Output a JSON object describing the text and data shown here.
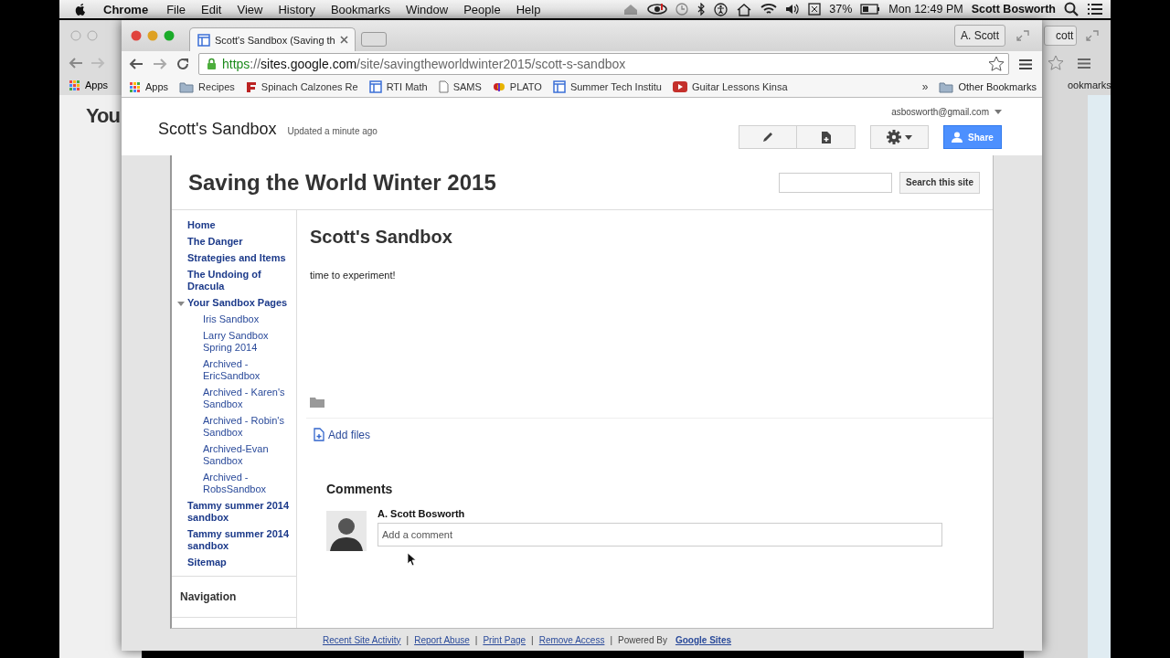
{
  "menu_bar": {
    "app": "Chrome",
    "items": [
      "File",
      "Edit",
      "View",
      "History",
      "Bookmarks",
      "Window",
      "People",
      "Help"
    ],
    "battery": "37%",
    "clock": "Mon 12:49 PM",
    "user": "Scott Bosworth"
  },
  "back_window_left": {
    "bookmark": "Apps",
    "page_logo": "You"
  },
  "back_window_right": {
    "profile_button": "cott",
    "bookmark": "ookmarks"
  },
  "browser": {
    "tabs": [
      {
        "title": "Scott's Sandbox (Saving th",
        "selected": true
      }
    ],
    "profile_button": "A. Scott",
    "url": {
      "scheme": "https",
      "separator": "://",
      "host": "sites.google.com",
      "path": "/site/savingtheworldwinter2015/scott-s-sandbox"
    },
    "bookmarks": [
      {
        "label": "Apps",
        "kind": "apps"
      },
      {
        "label": "Recipes",
        "kind": "folder"
      },
      {
        "label": "Spinach Calzones Re",
        "kind": "food"
      },
      {
        "label": "RTI Math",
        "kind": "sites"
      },
      {
        "label": "SAMS",
        "kind": "doc"
      },
      {
        "label": "PLATO",
        "kind": "plato"
      },
      {
        "label": "Summer Tech Institu",
        "kind": "sites"
      },
      {
        "label": "Guitar Lessons Kinsa",
        "kind": "video"
      }
    ],
    "bookmarks_overflow": "»",
    "other_bookmarks": "Other Bookmarks"
  },
  "site": {
    "page_name": "Scott's Sandbox",
    "updated": "Updated a minute ago",
    "account": "asbosworth@gmail.com",
    "share_button": "Share",
    "site_title": "Saving the World Winter 2015",
    "search_button": "Search this site",
    "nav": [
      {
        "label": "Home"
      },
      {
        "label": "The Danger"
      },
      {
        "label": "Strategies and Items"
      },
      {
        "label": "The Undoing of Dracula"
      },
      {
        "label": "Your Sandbox Pages",
        "expanded": true,
        "children": [
          {
            "label": "Iris Sandbox"
          },
          {
            "label": "Larry Sandbox Spring 2014"
          },
          {
            "label": "Archived - EricSandbox"
          },
          {
            "label": "Archived - Karen's Sandbox"
          },
          {
            "label": "Archived - Robin's Sandbox"
          },
          {
            "label": "Archived-Evan Sandbox"
          },
          {
            "label": "Archived - RobsSandbox"
          }
        ]
      },
      {
        "label": "Tammy summer 2014 sandbox"
      },
      {
        "label": "Tammy summer 2014 sandbox"
      },
      {
        "label": "Sitemap"
      }
    ],
    "nav_heading": "Navigation",
    "page": {
      "title": "Scott's Sandbox",
      "body": "time to experiment!",
      "add_files": "Add files"
    },
    "comments": {
      "heading": "Comments",
      "author": "A. Scott Bosworth",
      "placeholder": "Add a comment"
    },
    "footer": [
      {
        "kind": "link",
        "label": "Recent Site Activity"
      },
      {
        "kind": "sep",
        "label": "|"
      },
      {
        "kind": "link",
        "label": "Report Abuse"
      },
      {
        "kind": "sep",
        "label": "|"
      },
      {
        "kind": "link",
        "label": "Print Page"
      },
      {
        "kind": "sep",
        "label": "|"
      },
      {
        "kind": "link",
        "label": "Remove Access"
      },
      {
        "kind": "sep",
        "label": "|"
      },
      {
        "kind": "text",
        "label": "Powered By"
      },
      {
        "kind": "brand",
        "label": "Google Sites"
      }
    ]
  }
}
